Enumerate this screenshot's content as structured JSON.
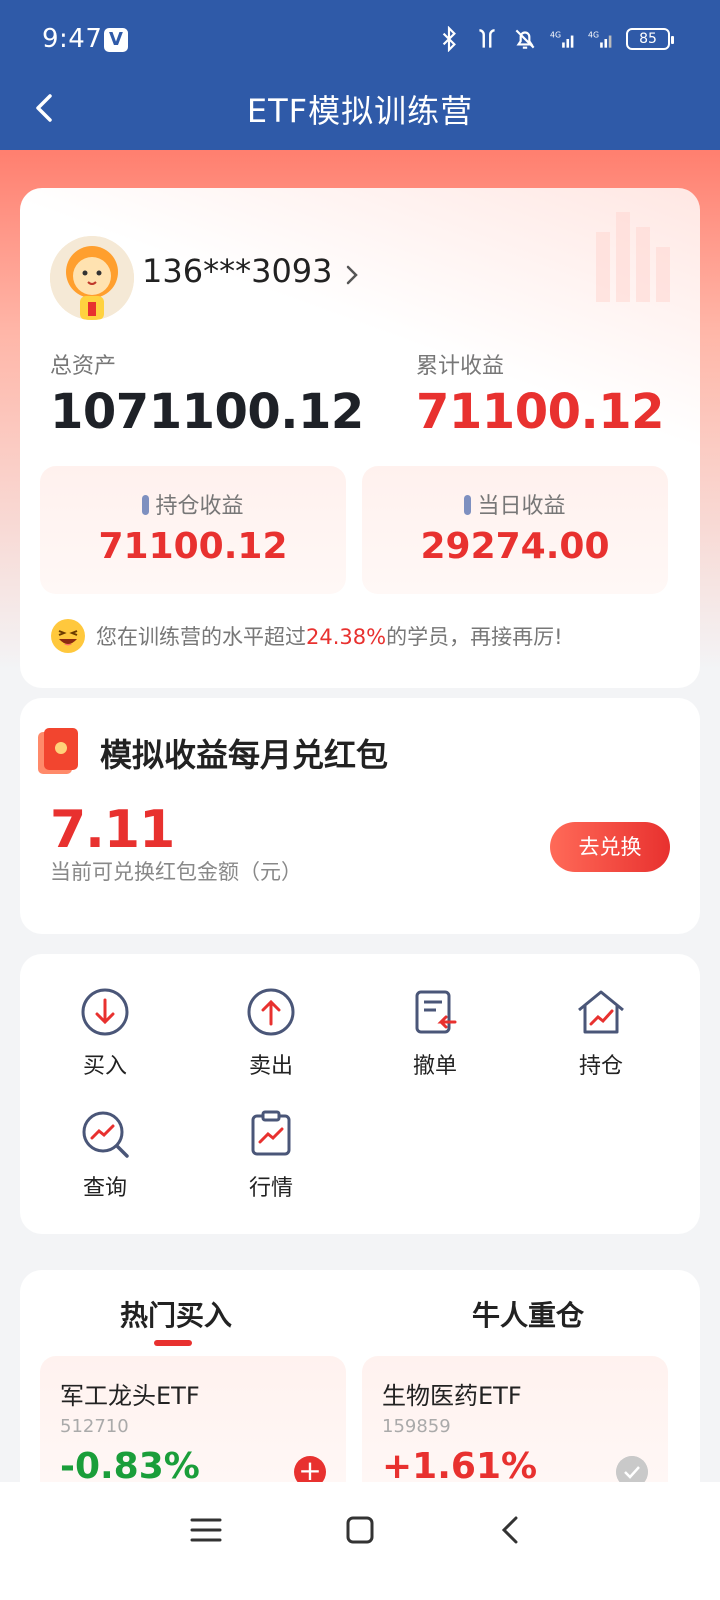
{
  "status_bar": {
    "time": "9:47",
    "app_icon_letter": "V",
    "battery": "85"
  },
  "header": {
    "title": "ETF模拟训练营"
  },
  "account": {
    "phone": "136***3093",
    "total_assets_label": "总资产",
    "total_assets_value": "1071100.12",
    "cumulative_label": "累计收益",
    "cumulative_value": "71100.12",
    "holding_label": "持仓收益",
    "holding_value": "71100.12",
    "daily_label": "当日收益",
    "daily_value": "29274.00",
    "rank_prefix": "您在训练营的水平超过",
    "rank_pct": "24.38%",
    "rank_suffix": "的学员，再接再厉!"
  },
  "redpacket": {
    "title": "模拟收益每月兑红包",
    "amount": "7.11",
    "amount_label": "当前可兑换红包金额（元）",
    "button": "去兑换"
  },
  "actions": [
    {
      "label": "买入",
      "icon": "buy-icon"
    },
    {
      "label": "卖出",
      "icon": "sell-icon"
    },
    {
      "label": "撤单",
      "icon": "cancel-order-icon"
    },
    {
      "label": "持仓",
      "icon": "holdings-icon"
    },
    {
      "label": "查询",
      "icon": "query-icon"
    },
    {
      "label": "行情",
      "icon": "market-icon"
    }
  ],
  "tabs": {
    "hot": "热门买入",
    "bull": "牛人重仓"
  },
  "etfs": [
    {
      "name": "军工龙头ETF",
      "code": "512710",
      "change": "-0.83%"
    },
    {
      "name": "生物医药ETF",
      "code": "159859",
      "change": "+1.61%"
    }
  ],
  "colors": {
    "header": "#2f5aa8",
    "accent_red": "#e8312f",
    "down_green": "#1a9e3a"
  }
}
